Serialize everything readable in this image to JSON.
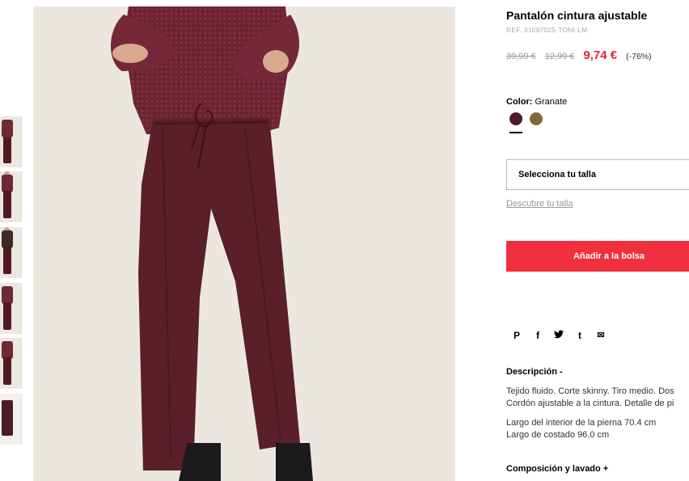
{
  "product": {
    "title": "Pantalón cintura ajustable",
    "ref": "REF. 31097025-TONI-LM",
    "old_price_1": "39,99 €",
    "old_price_2": "12,99 €",
    "price": "9,74 €",
    "discount": "(-76%)"
  },
  "color": {
    "label": "Color:",
    "value": "Granate",
    "swatches": [
      {
        "name": "granate",
        "hex": "#4a1c2b"
      },
      {
        "name": "kaki",
        "hex": "#7d6a3a"
      }
    ]
  },
  "size": {
    "select_label": "Selecciona tu talla",
    "guide_link": "Descubre tu talla"
  },
  "cart": {
    "add_label": "Añadir a la bolsa"
  },
  "share": {
    "pinterest": "P",
    "facebook": "f",
    "twitter": "🐦",
    "tumblr": "t",
    "email": "✉"
  },
  "description": {
    "title": "Descripción -",
    "line1": "Tejido fluido. Corte skinny. Tiro medio. Dos",
    "line2": "Cordón ajustable a la cintura. Detalle de pi",
    "line3": "Largo del interior de la pierna 70.4 cm",
    "line4": "Largo de costado 96.0 cm"
  },
  "composition": {
    "title": "Composición y lavado +"
  },
  "colors": {
    "accent": "#f0303f",
    "sale_price": "#e5243a",
    "garment": "#5a1f2b"
  }
}
